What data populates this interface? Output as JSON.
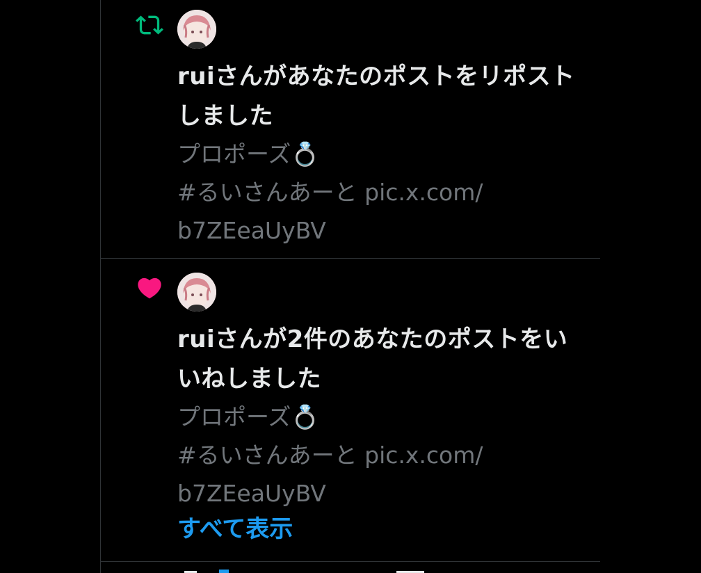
{
  "colors": {
    "background": "#000000",
    "repost_green": "#00ba7c",
    "like_pink": "#f91880",
    "primary_text": "#e7e9ea",
    "secondary_text": "#71767b",
    "link_blue": "#1d9bf0",
    "border": "#2f3336"
  },
  "notifications": [
    {
      "type_icon": "repost-icon",
      "avatar": "user-avatar",
      "headline": "ruiさんがあなたのポストをリポストしました",
      "headline_lines": [
        "ruiさんがあなたのポストをリポスト",
        "しました"
      ],
      "post_lines": [
        "プロポーズ💍",
        "#るいさんあーと pic.x.com/",
        "b7ZEeaUyBV"
      ]
    },
    {
      "type_icon": "heart-icon",
      "avatar": "user-avatar",
      "headline": "ruiさんが2件のあなたのポストをいいねしました",
      "headline_lines": [
        "ruiさんが2件のあなたのポストをい",
        "いねしました"
      ],
      "post_lines": [
        "プロポーズ💍",
        "#るいさんあーと pic.x.com/",
        "b7ZEeaUyBV"
      ],
      "show_all": "すべて表示"
    }
  ]
}
